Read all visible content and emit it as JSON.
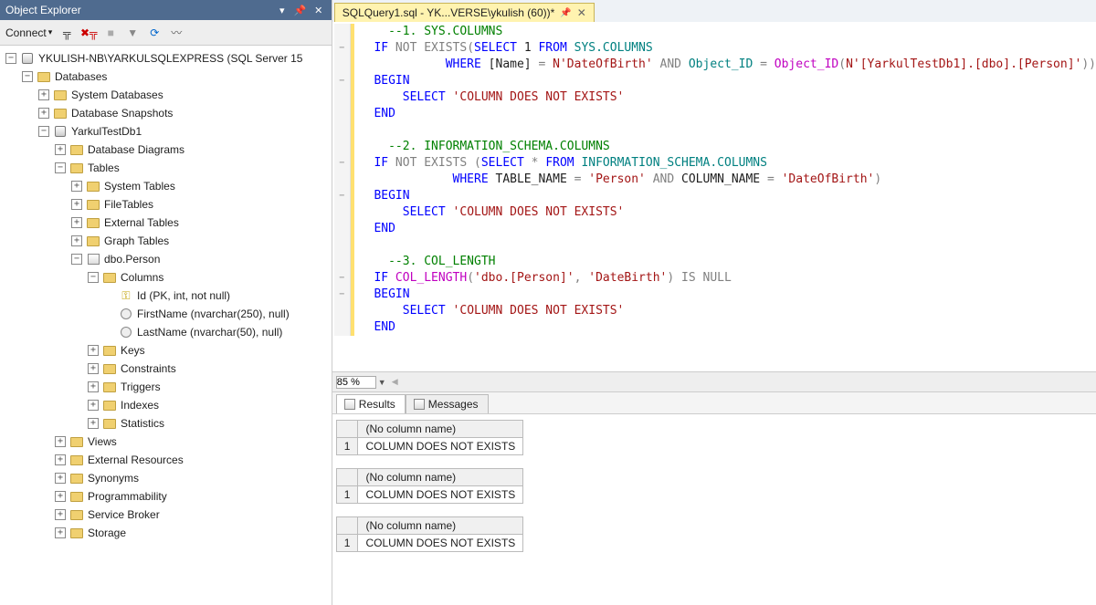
{
  "explorer": {
    "title": "Object Explorer",
    "connect": "Connect",
    "tree": {
      "server": "YKULISH-NB\\YARKULSQLEXPRESS (SQL Server 15",
      "databases": "Databases",
      "sysdb": "System Databases",
      "snapshots": "Database Snapshots",
      "db1": "YarkulTestDb1",
      "diagrams": "Database Diagrams",
      "tables": "Tables",
      "systables": "System Tables",
      "filetables": "FileTables",
      "exttables": "External Tables",
      "graphtables": "Graph Tables",
      "dbo_person": "dbo.Person",
      "columns": "Columns",
      "col_id": "Id (PK, int, not null)",
      "col_first": "FirstName (nvarchar(250), null)",
      "col_last": "LastName (nvarchar(50), null)",
      "keys": "Keys",
      "constraints": "Constraints",
      "triggers": "Triggers",
      "indexes": "Indexes",
      "statistics": "Statistics",
      "views": "Views",
      "extres": "External Resources",
      "synonyms": "Synonyms",
      "programmability": "Programmability",
      "servicebroker": "Service Broker",
      "storage": "Storage"
    }
  },
  "tab": {
    "label": "SQLQuery1.sql - YK...VERSE\\ykulish (60))*"
  },
  "sql": {
    "c1": "--1. SYS.COLUMNS",
    "if": "IF",
    "not": "NOT",
    "exists": "EXISTS",
    "select": "SELECT",
    "one": "1",
    "from": "FROM",
    "sys_cols": "SYS.COLUMNS",
    "where": "WHERE",
    "name_b": "[Name]",
    "eq": " = ",
    "nprefix": "N",
    "str_dob": "'DateOfBirth'",
    "and": "AND",
    "objid": "Object_ID",
    "objidfn": "Object_ID",
    "str_obj": "N'[YarkulTestDb1].[dbo].[Person]'",
    "begin": "BEGIN",
    "end": "END",
    "sel_msg": "'COLUMN DOES NOT EXISTS'",
    "c2": "--2. INFORMATION_SCHEMA.COLUMNS",
    "star": "*",
    "infocols": "INFORMATION_SCHEMA.COLUMNS",
    "tname": "TABLE_NAME",
    "str_person": "'Person'",
    "cname": "COLUMN_NAME",
    "c3": "--3. COL_LENGTH",
    "collen": "COL_LENGTH",
    "str_dboperson": "'dbo.[Person]'",
    "comma": ", ",
    "str_datebirth": "'DateBirth'",
    "is": "IS",
    "null": "NULL"
  },
  "zoom": "85 %",
  "result_tabs": {
    "results": "Results",
    "messages": "Messages"
  },
  "grids": [
    {
      "header": "(No column name)",
      "rownum": "1",
      "value": "COLUMN DOES NOT EXISTS"
    },
    {
      "header": "(No column name)",
      "rownum": "1",
      "value": "COLUMN DOES NOT EXISTS"
    },
    {
      "header": "(No column name)",
      "rownum": "1",
      "value": "COLUMN DOES NOT EXISTS"
    }
  ]
}
